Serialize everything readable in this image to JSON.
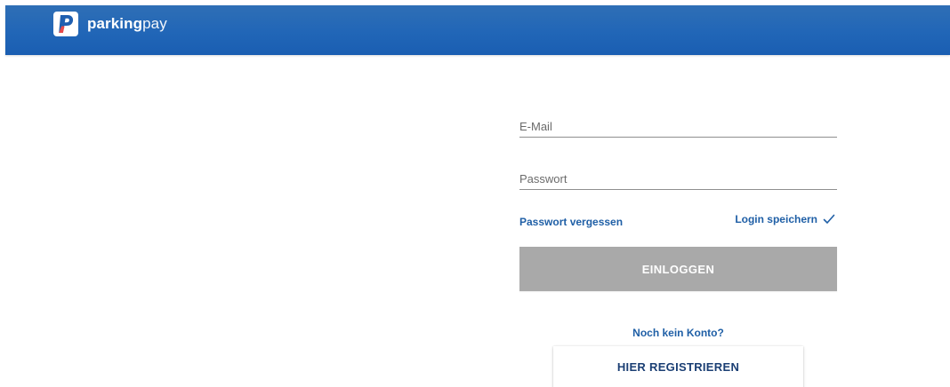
{
  "header": {
    "brand_bold": "parking",
    "brand_light": "pay",
    "logo_icon": "parkingpay-p-logo-icon",
    "background_color": "#2166b7"
  },
  "login_form": {
    "email_placeholder": "E-Mail",
    "email_value": "",
    "password_placeholder": "Passwort",
    "password_value": "",
    "forgot_password_label": "Passwort vergessen",
    "remember_login_label": "Login speichern",
    "remember_login_checked": true,
    "remember_icon": "checkmark-icon",
    "login_button_label": "EINLOGGEN",
    "login_button_color": "#a9a9a9"
  },
  "registration": {
    "prompt_text": "Noch kein Konto?",
    "register_button_label": "HIER REGISTRIEREN"
  },
  "colors": {
    "link": "#1f5fa6",
    "register_text": "#1b3f74"
  }
}
